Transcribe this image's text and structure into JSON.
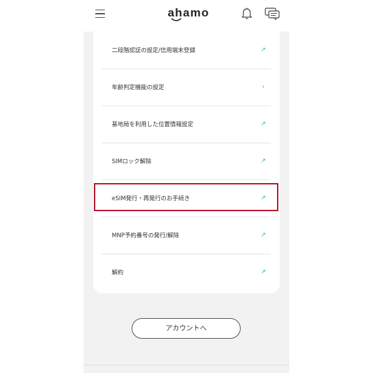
{
  "header": {
    "logo_text": "ahamo",
    "menu_icon": "hamburger-menu-icon",
    "bell_icon": "bell-icon",
    "chat_icon": "chat-bubbles-icon"
  },
  "menu_items": [
    {
      "label": "二段階認証の設定/信用端末登録",
      "arrow": "↗"
    },
    {
      "label": "年齢判定機能の設定",
      "arrow": "›"
    },
    {
      "label": "基地局を利用した位置情報設定",
      "arrow": "↗"
    },
    {
      "label": "SIMロック解除",
      "arrow": "↗"
    },
    {
      "label": "eSIM発行・再発行のお手続き",
      "arrow": "↗"
    },
    {
      "label": "MNP予約番号の発行/解除",
      "arrow": "↗"
    },
    {
      "label": "解約",
      "arrow": "↗"
    }
  ],
  "account_button": "アカウントへ",
  "colors": {
    "accent": "#22b5a8",
    "highlight": "#b3182f",
    "background": "#f2f2f2"
  }
}
